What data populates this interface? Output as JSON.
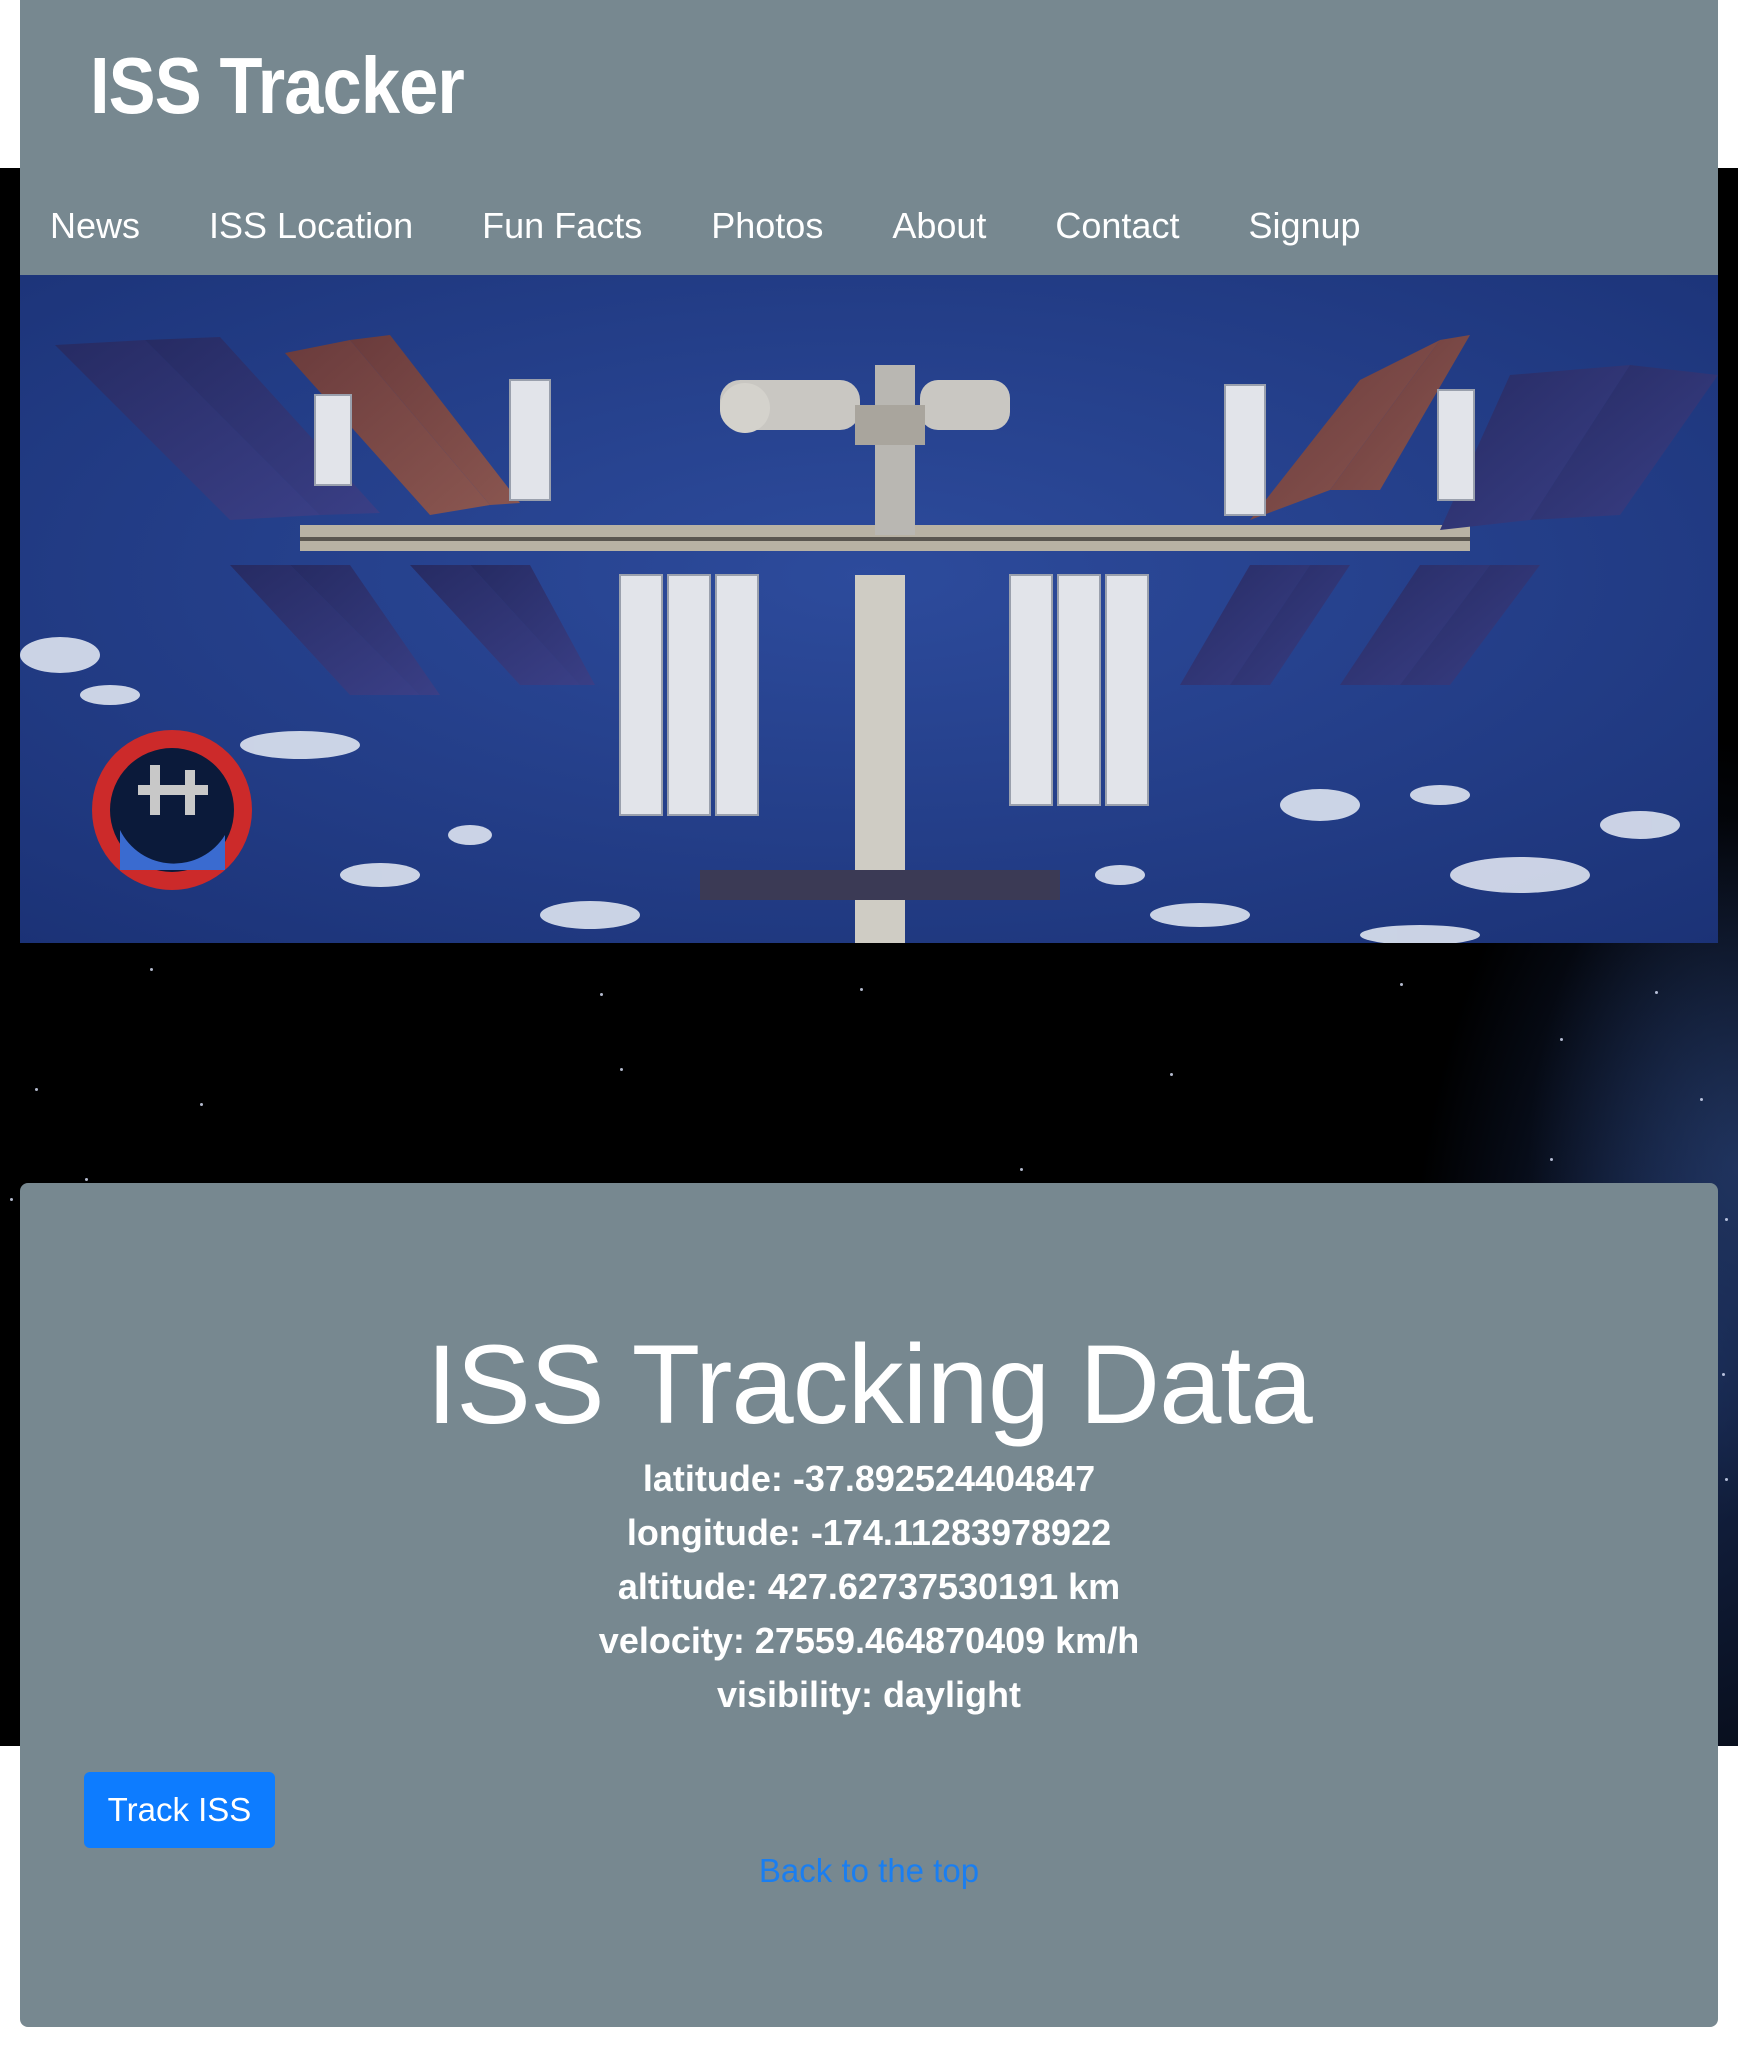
{
  "header": {
    "title": "ISS Tracker",
    "nav": [
      "News",
      "ISS Location",
      "Fun Facts",
      "Photos",
      "About",
      "Contact",
      "Signup"
    ]
  },
  "hero": {
    "image_alt": "International Space Station over Earth"
  },
  "tracking": {
    "title": "ISS Tracking Data",
    "latitude": "latitude: -37.892524404847",
    "longitude": "longitude: -174.11283978922",
    "altitude": "altitude: 427.62737530191 km",
    "velocity": "velocity: 27559.464870409 km/h",
    "visibility": "visibility: daylight"
  },
  "actions": {
    "track_button": "Track ISS",
    "back_to_top": "Back to the top"
  },
  "colors": {
    "panel": "#778890",
    "button": "#0d7cff",
    "link": "#1a7ef0",
    "space": "#000000",
    "earth": "#24408c"
  }
}
